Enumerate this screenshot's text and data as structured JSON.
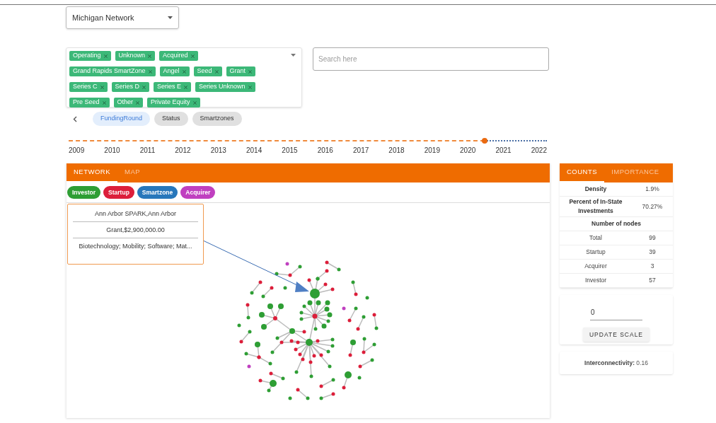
{
  "dataset_select": {
    "value": "Michigan Network"
  },
  "filter_tags": [
    "Operating",
    "Unknown",
    "Acquired",
    "Grand Rapids SmartZone",
    "Angel",
    "Seed",
    "Grant",
    "Series C",
    "Series D",
    "Series E",
    "Series Unknown",
    "Pre Seed",
    "Other",
    "Private Equity"
  ],
  "search": {
    "placeholder": "Search here"
  },
  "filter_tabs": [
    {
      "label": "FundingRound",
      "selected": true
    },
    {
      "label": "Status",
      "selected": false
    },
    {
      "label": "Smartzones",
      "selected": false
    }
  ],
  "timeline": {
    "level": 0.87,
    "years": [
      "2009",
      "2010",
      "2011",
      "2012",
      "2013",
      "2014",
      "2015",
      "2016",
      "2017",
      "2018",
      "2019",
      "2020",
      "2021",
      "2022"
    ]
  },
  "network_panel": {
    "tabs": [
      {
        "label": "NETWORK",
        "selected": true
      },
      {
        "label": "MAP",
        "selected": false
      }
    ],
    "legend": [
      {
        "label": "Investor",
        "color": "#2e9e34"
      },
      {
        "label": "Startup",
        "color": "#dc1e3a"
      },
      {
        "label": "Smartzone",
        "color": "#2777bb"
      },
      {
        "label": "Acquirer",
        "color": "#c040c0"
      }
    ],
    "tooltip": [
      "Ann Arbor SPARK,Ann Arbor",
      "Grant,$2,900,000.00",
      "Biotechnology; Mobility; Software; Mat..."
    ]
  },
  "stats": {
    "tabs": [
      {
        "label": "COUNTS",
        "selected": true
      },
      {
        "label": "IMPORTANCE",
        "selected": false
      }
    ],
    "rows": [
      {
        "kind": "metric",
        "label": "Density",
        "value": "1.9%"
      },
      {
        "kind": "metric",
        "label": "Percent of In-State Investments",
        "value": "70.27%"
      },
      {
        "kind": "header",
        "label": "Number of nodes"
      },
      {
        "kind": "count",
        "label": "Total",
        "value": "99"
      },
      {
        "kind": "count",
        "label": "Startup",
        "value": "39"
      },
      {
        "kind": "count",
        "label": "Acquirer",
        "value": "3"
      },
      {
        "kind": "count",
        "label": "Investor",
        "value": "57"
      }
    ]
  },
  "scale": {
    "value": "0",
    "button": "UPDATE SCALE"
  },
  "interconnectivity": {
    "label": "Interconnectivity:",
    "value": "0.16"
  }
}
